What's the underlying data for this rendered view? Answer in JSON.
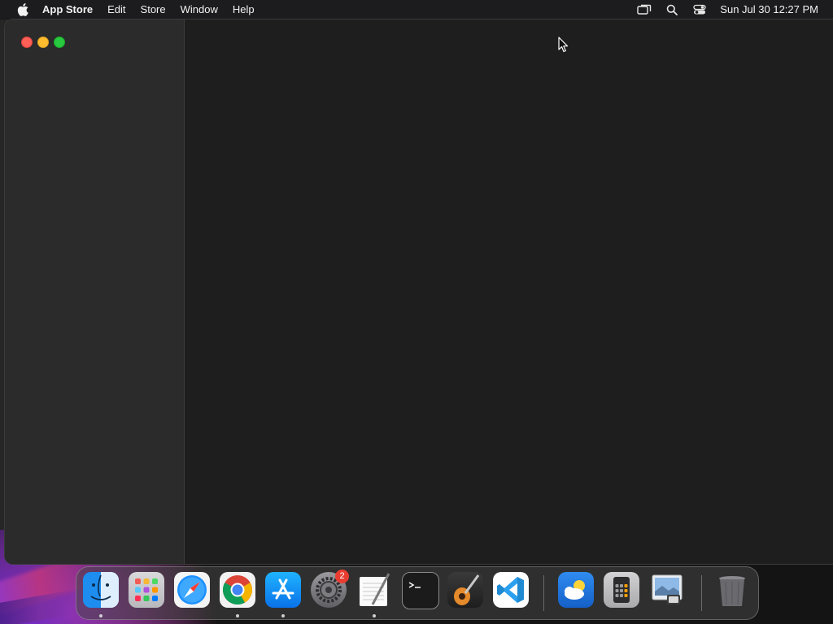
{
  "menubar": {
    "apple_icon": "apple-logo-icon",
    "app_name": "App Store",
    "items": [
      "Edit",
      "Store",
      "Window",
      "Help"
    ],
    "status_icons": [
      "screen-mirroring-icon",
      "spotlight-search-icon",
      "control-center-icon"
    ],
    "clock": "Sun Jul 30  12:27 PM"
  },
  "window": {
    "traffic_lights": [
      "close",
      "minimize",
      "zoom"
    ],
    "colors": {
      "close": "#fe5f57",
      "minimize": "#febc2e",
      "zoom": "#28c840",
      "sidebar": "#2b2b2b",
      "content": "#1e1e1e"
    }
  },
  "dock": {
    "apps": [
      {
        "name": "Finder",
        "icon": "finder-icon",
        "running": true
      },
      {
        "name": "Launchpad",
        "icon": "launchpad-icon",
        "running": false
      },
      {
        "name": "Safari",
        "icon": "safari-icon",
        "running": false
      },
      {
        "name": "Google Chrome",
        "icon": "chrome-icon",
        "running": true
      },
      {
        "name": "App Store",
        "icon": "app-store-icon",
        "running": true
      },
      {
        "name": "System Settings",
        "icon": "system-settings-icon",
        "running": false,
        "badge": "2"
      },
      {
        "name": "TextEdit",
        "icon": "textedit-icon",
        "running": true
      },
      {
        "name": "Terminal",
        "icon": "terminal-icon",
        "running": false
      },
      {
        "name": "GarageBand",
        "icon": "garageband-icon",
        "running": false
      },
      {
        "name": "Visual Studio Code",
        "icon": "vscode-icon",
        "running": false
      },
      {
        "name": "Weather",
        "icon": "weather-icon",
        "running": false
      },
      {
        "name": "Calculator",
        "icon": "calculator-icon",
        "running": false
      },
      {
        "name": "Preview",
        "icon": "preview-icon",
        "running": false
      },
      {
        "name": "Trash",
        "icon": "trash-icon",
        "running": false
      }
    ]
  }
}
